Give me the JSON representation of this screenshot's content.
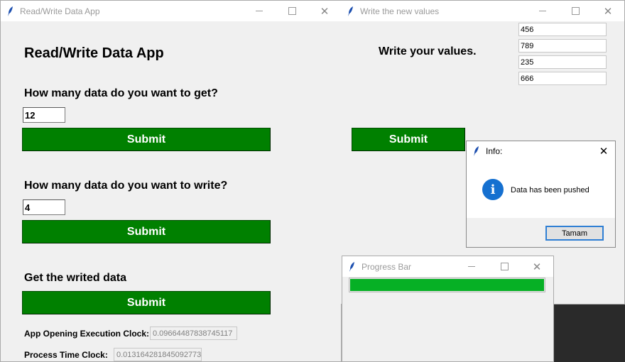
{
  "main_window": {
    "title": "Read/Write Data App",
    "heading": "Read/Write Data App",
    "get_question": "How many data do you want to get?",
    "get_value": "12",
    "get_submit": "Submit",
    "write_question": "How many data do you want to write?",
    "write_value": "4",
    "write_submit": "Submit",
    "writed_label": "Get the writed data",
    "writed_submit": "Submit",
    "opening_clock_label": "App Opening Execution Clock:",
    "opening_clock_value": "0.09664487838745117",
    "process_clock_label": "Process Time Clock:",
    "process_clock_value": "0.013164281845092773"
  },
  "values_window": {
    "title": "Write the new values",
    "prompt": "Write your values.",
    "values": [
      "456",
      "789",
      "235",
      "666"
    ],
    "submit": "Submit"
  },
  "info_dialog": {
    "title": "Info:",
    "message": "Data has been pushed",
    "ok_button": "Tamam",
    "icon": "info-icon"
  },
  "progress_window": {
    "title": "Progress Bar",
    "progress_fraction": 1.0,
    "bar_color": "#06b025"
  },
  "colors": {
    "submit_green": "#008000",
    "info_blue": "#1570d0"
  }
}
